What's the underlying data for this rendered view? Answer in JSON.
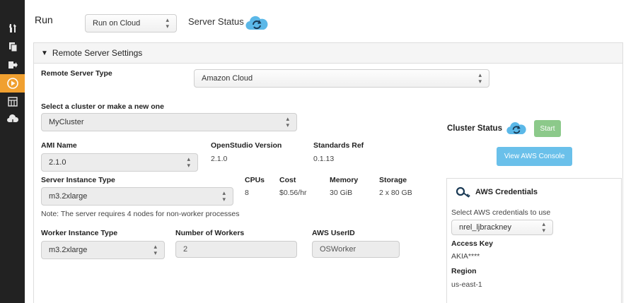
{
  "sidebar": {
    "items": [
      {
        "icon": "tools-icon"
      },
      {
        "icon": "documents-icon"
      },
      {
        "icon": "export-icon"
      },
      {
        "icon": "run-icon",
        "active": true
      },
      {
        "icon": "results-icon"
      },
      {
        "icon": "cloud-download-icon"
      }
    ]
  },
  "run": {
    "label": "Run",
    "mode": {
      "value": "Run on Cloud"
    },
    "server_status_label": "Server Status"
  },
  "panel": {
    "title": "Remote Server Settings",
    "remote_server_type": {
      "label": "Remote Server Type",
      "value": "Amazon Cloud"
    },
    "cluster": {
      "label": "Select a cluster or make a new one",
      "value": "MyCluster"
    },
    "ami": {
      "label": "AMI Name",
      "value": "2.1.0"
    },
    "openstudio_version": {
      "label": "OpenStudio Version",
      "value": "2.1.0"
    },
    "standards_ref": {
      "label": "Standards Ref",
      "value": "0.1.13"
    },
    "server_instance": {
      "label": "Server Instance Type",
      "value": "m3.2xlarge",
      "cpus_label": "CPUs",
      "cpus": "8",
      "cost_label": "Cost",
      "cost": "$0.56/hr",
      "memory_label": "Memory",
      "memory": "30 GiB",
      "storage_label": "Storage",
      "storage": "2 x 80 GB"
    },
    "note": "Note: The server requires 4 nodes for non-worker processes",
    "worker_instance": {
      "label": "Worker Instance Type",
      "value": "m3.2xlarge"
    },
    "num_workers": {
      "label": "Number of Workers",
      "value": "2"
    },
    "aws_userid": {
      "label": "AWS UserID",
      "value": "OSWorker"
    },
    "cluster_status": {
      "label": "Cluster Status",
      "start_label": "Start"
    },
    "view_console_label": "View AWS Console",
    "credentials": {
      "title": "AWS Credentials",
      "select_label": "Select AWS credentials to use",
      "selected": "nrel_ljbrackney",
      "access_key_label": "Access Key",
      "access_key": "AKIA****",
      "region_label": "Region",
      "region": "us-east-1"
    }
  },
  "colors": {
    "sidebar_bg": "#222222",
    "active_accent": "#f0a030",
    "start_green": "#8cc98a",
    "aws_blue": "#6ac0ea",
    "cloud_blue": "#5bb8e8"
  }
}
